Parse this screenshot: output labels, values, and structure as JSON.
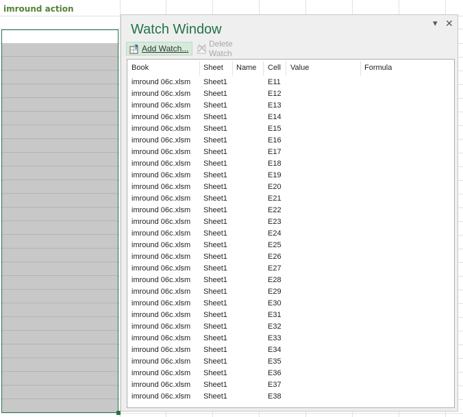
{
  "sheet": {
    "cell_title": "imround action"
  },
  "watch_window": {
    "title": "Watch Window",
    "add_watch_label": "Add Watch...",
    "delete_watch_label": "Delete Watch",
    "dropdown_glyph": "▾",
    "close_glyph": "✕",
    "columns": [
      "Book",
      "Sheet",
      "Name",
      "Cell",
      "Value",
      "Formula"
    ],
    "rows": [
      {
        "book": "imround 06c.xlsm",
        "sheet": "Sheet1",
        "name": "",
        "cell": "E11",
        "value": "",
        "formula": ""
      },
      {
        "book": "imround 06c.xlsm",
        "sheet": "Sheet1",
        "name": "",
        "cell": "E12",
        "value": "",
        "formula": ""
      },
      {
        "book": "imround 06c.xlsm",
        "sheet": "Sheet1",
        "name": "",
        "cell": "E13",
        "value": "",
        "formula": ""
      },
      {
        "book": "imround 06c.xlsm",
        "sheet": "Sheet1",
        "name": "",
        "cell": "E14",
        "value": "",
        "formula": ""
      },
      {
        "book": "imround 06c.xlsm",
        "sheet": "Sheet1",
        "name": "",
        "cell": "E15",
        "value": "",
        "formula": ""
      },
      {
        "book": "imround 06c.xlsm",
        "sheet": "Sheet1",
        "name": "",
        "cell": "E16",
        "value": "",
        "formula": ""
      },
      {
        "book": "imround 06c.xlsm",
        "sheet": "Sheet1",
        "name": "",
        "cell": "E17",
        "value": "",
        "formula": ""
      },
      {
        "book": "imround 06c.xlsm",
        "sheet": "Sheet1",
        "name": "",
        "cell": "E18",
        "value": "",
        "formula": ""
      },
      {
        "book": "imround 06c.xlsm",
        "sheet": "Sheet1",
        "name": "",
        "cell": "E19",
        "value": "",
        "formula": ""
      },
      {
        "book": "imround 06c.xlsm",
        "sheet": "Sheet1",
        "name": "",
        "cell": "E20",
        "value": "",
        "formula": ""
      },
      {
        "book": "imround 06c.xlsm",
        "sheet": "Sheet1",
        "name": "",
        "cell": "E21",
        "value": "",
        "formula": ""
      },
      {
        "book": "imround 06c.xlsm",
        "sheet": "Sheet1",
        "name": "",
        "cell": "E22",
        "value": "",
        "formula": ""
      },
      {
        "book": "imround 06c.xlsm",
        "sheet": "Sheet1",
        "name": "",
        "cell": "E23",
        "value": "",
        "formula": ""
      },
      {
        "book": "imround 06c.xlsm",
        "sheet": "Sheet1",
        "name": "",
        "cell": "E24",
        "value": "",
        "formula": ""
      },
      {
        "book": "imround 06c.xlsm",
        "sheet": "Sheet1",
        "name": "",
        "cell": "E25",
        "value": "",
        "formula": ""
      },
      {
        "book": "imround 06c.xlsm",
        "sheet": "Sheet1",
        "name": "",
        "cell": "E26",
        "value": "",
        "formula": ""
      },
      {
        "book": "imround 06c.xlsm",
        "sheet": "Sheet1",
        "name": "",
        "cell": "E27",
        "value": "",
        "formula": ""
      },
      {
        "book": "imround 06c.xlsm",
        "sheet": "Sheet1",
        "name": "",
        "cell": "E28",
        "value": "",
        "formula": ""
      },
      {
        "book": "imround 06c.xlsm",
        "sheet": "Sheet1",
        "name": "",
        "cell": "E29",
        "value": "",
        "formula": ""
      },
      {
        "book": "imround 06c.xlsm",
        "sheet": "Sheet1",
        "name": "",
        "cell": "E30",
        "value": "",
        "formula": ""
      },
      {
        "book": "imround 06c.xlsm",
        "sheet": "Sheet1",
        "name": "",
        "cell": "E31",
        "value": "",
        "formula": ""
      },
      {
        "book": "imround 06c.xlsm",
        "sheet": "Sheet1",
        "name": "",
        "cell": "E32",
        "value": "",
        "formula": ""
      },
      {
        "book": "imround 06c.xlsm",
        "sheet": "Sheet1",
        "name": "",
        "cell": "E33",
        "value": "",
        "formula": ""
      },
      {
        "book": "imround 06c.xlsm",
        "sheet": "Sheet1",
        "name": "",
        "cell": "E34",
        "value": "",
        "formula": ""
      },
      {
        "book": "imround 06c.xlsm",
        "sheet": "Sheet1",
        "name": "",
        "cell": "E35",
        "value": "",
        "formula": ""
      },
      {
        "book": "imround 06c.xlsm",
        "sheet": "Sheet1",
        "name": "",
        "cell": "E36",
        "value": "",
        "formula": ""
      },
      {
        "book": "imround 06c.xlsm",
        "sheet": "Sheet1",
        "name": "",
        "cell": "E37",
        "value": "",
        "formula": ""
      },
      {
        "book": "imround 06c.xlsm",
        "sheet": "Sheet1",
        "name": "",
        "cell": "E38",
        "value": "",
        "formula": ""
      }
    ]
  },
  "icons": {
    "add_watch": "add-watch-icon",
    "delete_watch": "delete-watch-icon"
  },
  "colors": {
    "accent_green": "#217346",
    "title_cell_green": "#548235",
    "selection_fill": "#c8c8c8",
    "add_button_bg": "#d6ebdb"
  }
}
